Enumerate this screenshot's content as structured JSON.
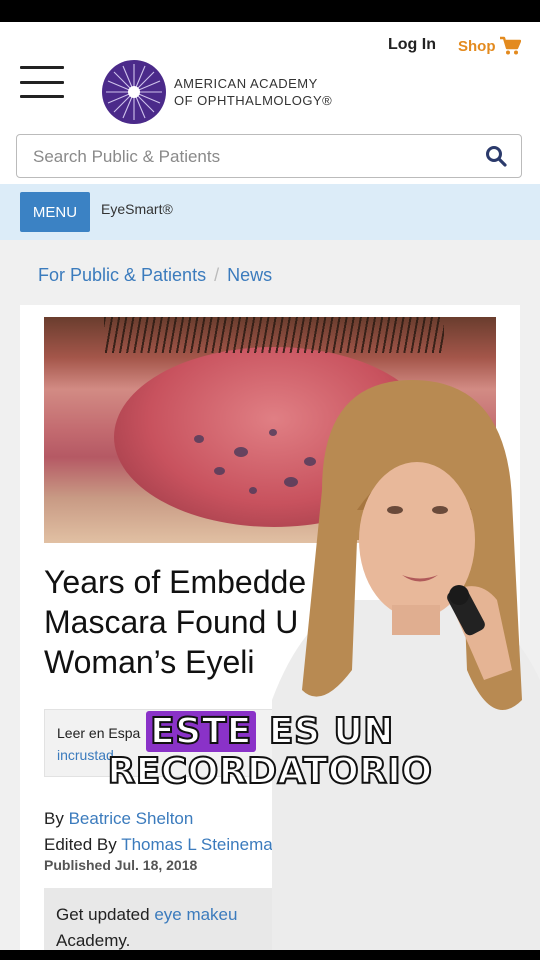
{
  "header": {
    "login_label": "Log In",
    "shop_label": "Shop",
    "brand_line1": "AMERICAN ACADEMY",
    "brand_line2": "OF OPHTHALMOLOGY®"
  },
  "search": {
    "placeholder": "Search Public & Patients"
  },
  "menubar": {
    "menu_label": "MENU",
    "eyesmart_label": "EyeSmart®"
  },
  "breadcrumb": {
    "item1": "For Public & Patients",
    "separator": "/",
    "item2": "News"
  },
  "article": {
    "title_line1": "Years of Embedde",
    "title_line2": "Mascara Found U",
    "title_line3": "Woman’s Eyeli",
    "leer_line1": "Leer en Espa",
    "leer_line2": "incrustad",
    "by_prefix": "By",
    "author": "Beatrice Shelton",
    "edited_prefix": "Edited By",
    "editor": "Thomas L Steineman",
    "published": "Published Jul. 18, 2018",
    "update_prefix": "Get updated",
    "update_link": "eye makeu",
    "update_line2": "Academy."
  },
  "caption": {
    "line1_highlight": "ESTE",
    "line1_rest": "ES UN",
    "line2": "RECORDATORIO"
  },
  "colors": {
    "accent_blue": "#3b82c4",
    "shop_orange": "#e38a1e",
    "logo_purple": "#4b2a8a",
    "caption_highlight": "#8a32c8"
  }
}
